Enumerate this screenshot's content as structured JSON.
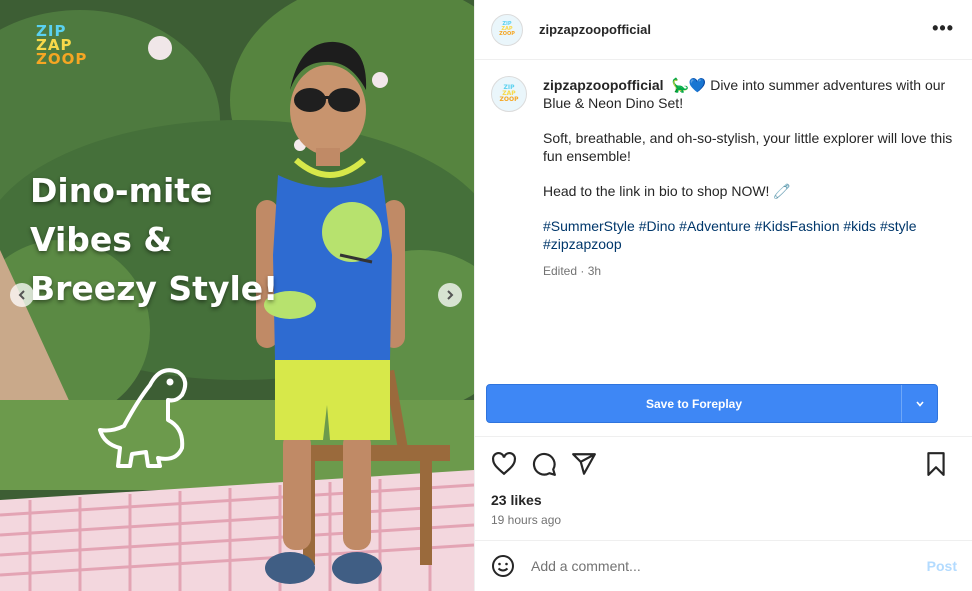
{
  "media": {
    "brand_logo": [
      "ZIP",
      "ZAP",
      "ZOOP"
    ],
    "headline": [
      "Dino-mite",
      "Vibes &",
      "Breezy Style!"
    ],
    "prev_icon": "chevron-left-icon",
    "next_icon": "chevron-right-icon"
  },
  "header": {
    "username": "zipzapzoopofficial",
    "more_icon": "more-horizontal-icon",
    "more_label": "•••"
  },
  "caption": {
    "username": "zipzapzoopofficial",
    "line1": "🦕💙 Dive into summer adventures with our Blue & Neon Dino Set!",
    "line2": "Soft, breathable, and oh-so-stylish, your little explorer will love this fun ensemble!",
    "line3": "Head to the link in bio to shop NOW! 🧷",
    "hashtags": "#SummerStyle #Dino #Adventure #KidsFashion #kids #style #zipzapzoop",
    "edited": "Edited · 3h"
  },
  "save_button": {
    "label": "Save to Foreplay",
    "dropdown_icon": "chevron-down-icon",
    "dropdown_label": "⌄",
    "color": "#3e87f5"
  },
  "actions": {
    "like_icon": "heart-icon",
    "comment_icon": "comment-icon",
    "share_icon": "share-icon",
    "save_icon": "bookmark-icon",
    "likes": "23 likes",
    "time": "19 hours ago"
  },
  "comment_box": {
    "emoji_icon": "emoji-icon",
    "placeholder": "Add a comment...",
    "post_label": "Post"
  }
}
